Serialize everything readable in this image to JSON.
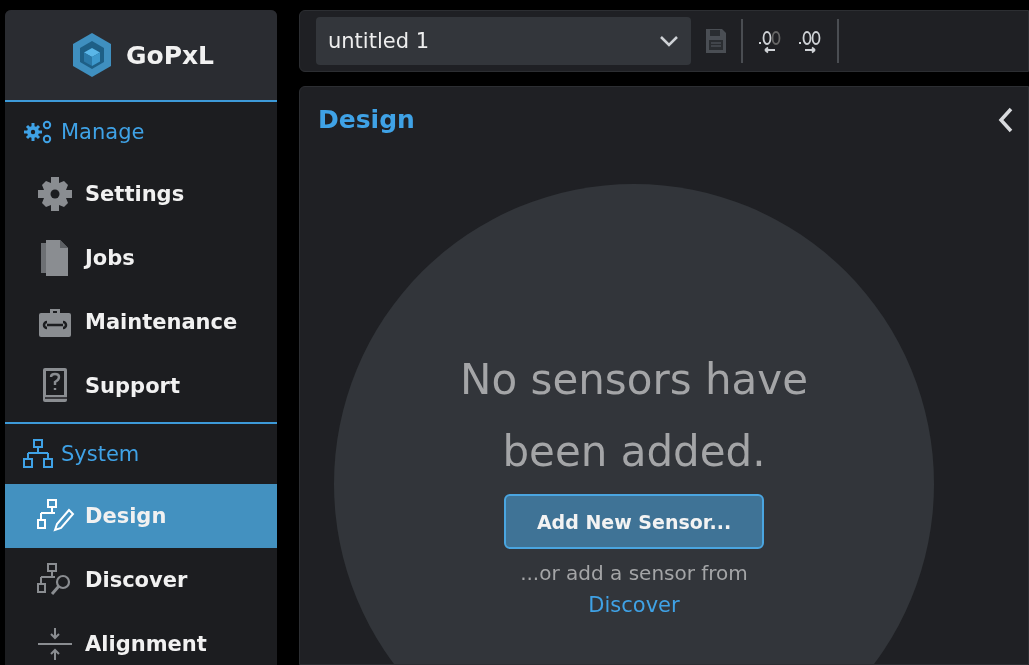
{
  "logo": {
    "text": "GoPxL"
  },
  "sidebar": {
    "sections": [
      {
        "title": "Manage",
        "kind": "manage",
        "items": [
          {
            "label": "Settings",
            "kind": "gear",
            "selected": false
          },
          {
            "label": "Jobs",
            "kind": "file",
            "selected": false
          },
          {
            "label": "Maintenance",
            "kind": "toolbox",
            "selected": false
          },
          {
            "label": "Support",
            "kind": "help",
            "selected": false
          }
        ]
      },
      {
        "title": "System",
        "kind": "system",
        "items": [
          {
            "label": "Design",
            "kind": "design",
            "selected": true
          },
          {
            "label": "Discover",
            "kind": "discover",
            "selected": false
          },
          {
            "label": "Alignment",
            "kind": "align",
            "selected": false
          }
        ]
      }
    ]
  },
  "toolbar": {
    "job_select": {
      "value": "untitled 1"
    }
  },
  "panel": {
    "title": "Design",
    "message": "No sensors have been added.",
    "button": "Add New Sensor...",
    "hint": "...or add a sensor from",
    "link": "Discover"
  }
}
